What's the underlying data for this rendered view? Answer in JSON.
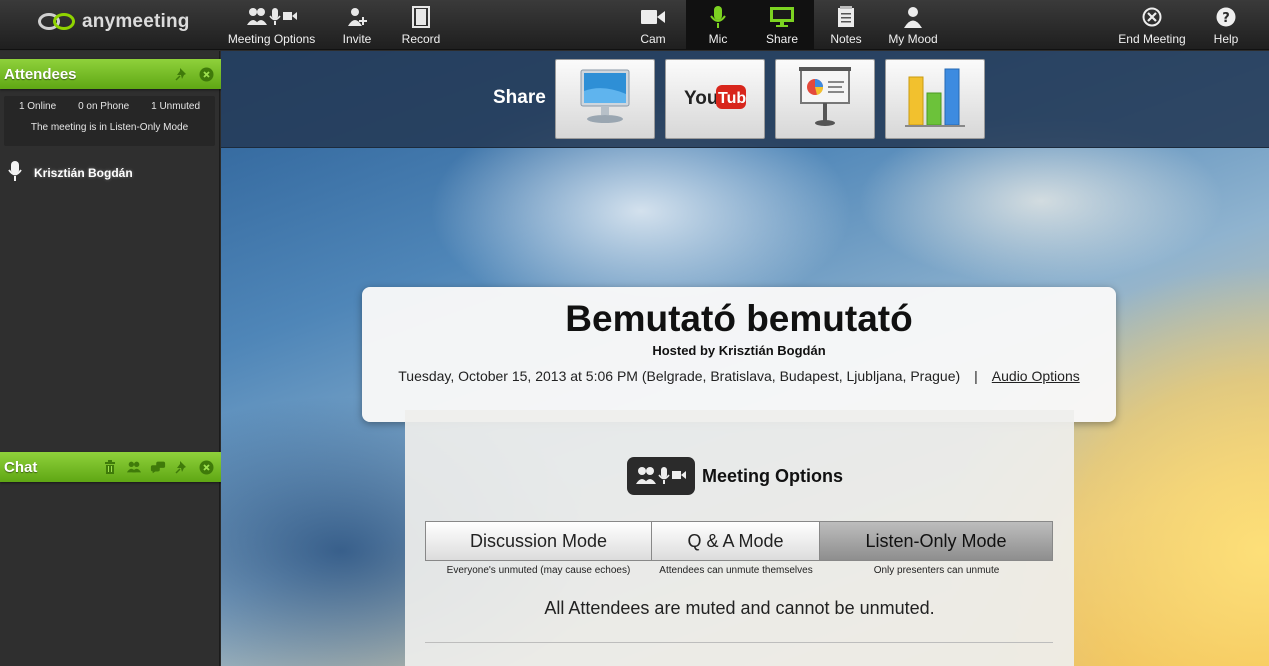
{
  "app": {
    "logo_text": "anymeeting"
  },
  "toolbar": {
    "meeting_options": "Meeting Options",
    "invite": "Invite",
    "record": "Record",
    "cam": "Cam",
    "mic": "Mic",
    "share": "Share",
    "notes": "Notes",
    "my_mood": "My Mood",
    "end_meeting": "End Meeting",
    "help": "Help"
  },
  "attendees_panel": {
    "title": "Attendees",
    "online": "1 Online",
    "on_phone": "0 on Phone",
    "unmuted": "1 Unmuted",
    "mode_text": "The meeting is in Listen-Only Mode",
    "attendees": [
      "Krisztián Bogdán"
    ]
  },
  "chat_panel": {
    "title": "Chat"
  },
  "share_bar": {
    "label": "Share"
  },
  "meeting": {
    "title": "Bemutató bemutató",
    "hosted_by": "Hosted by Krisztián Bogdán",
    "datetime": "Tuesday, October 15, 2013 at 5:06 PM (Belgrade, Bratislava, Budapest, Ljubljana, Prague)",
    "separator": "|",
    "audio_options": "Audio Options"
  },
  "meeting_options": {
    "title": "Meeting Options",
    "modes": [
      {
        "label": "Discussion Mode",
        "sub": "Everyone's unmuted (may cause echoes)",
        "selected": false
      },
      {
        "label": "Q & A Mode",
        "sub": "Attendees can unmute themselves",
        "selected": false
      },
      {
        "label": "Listen-Only Mode",
        "sub": "Only presenters can unmute",
        "selected": true
      }
    ],
    "status": "All Attendees are muted and cannot be unmuted."
  },
  "colors": {
    "accent_green": "#7cc221",
    "toolbar_bg": "#2a2a2a"
  },
  "icons": [
    "people-icon",
    "mic-icon",
    "camera-icon",
    "add-person-icon",
    "film-icon",
    "monitor-icon",
    "notes-icon",
    "person-icon",
    "close-circle-icon",
    "help-circle-icon",
    "pin-icon",
    "trash-icon",
    "chat-bubbles-icon",
    "youtube-icon",
    "presentation-icon",
    "bar-chart-icon"
  ]
}
